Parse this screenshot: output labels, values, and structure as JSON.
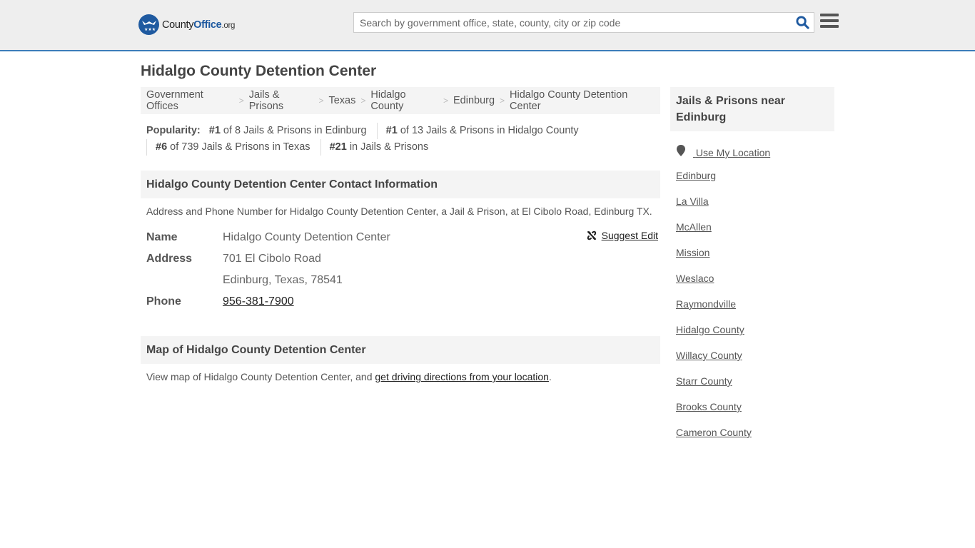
{
  "header": {
    "logo": {
      "text_main": "County",
      "text_bold": "Office",
      "text_suffix": ".org"
    },
    "search": {
      "placeholder": "Search by government office, state, county, city or zip code",
      "value": ""
    },
    "colors": {
      "brand": "#1f5aa0",
      "accent_border": "#3c7dba"
    }
  },
  "page": {
    "title": "Hidalgo County Detention Center"
  },
  "breadcrumb": [
    {
      "label": "Government Offices"
    },
    {
      "label": "Jails & Prisons"
    },
    {
      "label": "Texas"
    },
    {
      "label": "Hidalgo County"
    },
    {
      "label": "Edinburg"
    },
    {
      "label": "Hidalgo County Detention Center"
    }
  ],
  "popularity": {
    "label": "Popularity:",
    "items": [
      {
        "rank": "#1",
        "text": " of 8 Jails & Prisons in Edinburg"
      },
      {
        "rank": "#1",
        "text": " of 13 Jails & Prisons in Hidalgo County"
      },
      {
        "rank": "#6",
        "text": " of 739 Jails & Prisons in Texas"
      },
      {
        "rank": "#21",
        "text": " in Jails & Prisons"
      }
    ]
  },
  "contact": {
    "heading": "Hidalgo County Detention Center Contact Information",
    "description": "Address and Phone Number for Hidalgo County Detention Center, a Jail & Prison, at El Cibolo Road, Edinburg TX.",
    "suggest_edit": "Suggest Edit",
    "fields": {
      "name_label": "Name",
      "name_value": "Hidalgo County Detention Center",
      "address_label": "Address",
      "address_line1": "701 El Cibolo Road",
      "address_line2": "Edinburg, Texas, 78541",
      "phone_label": "Phone",
      "phone_value": "956-381-7900"
    }
  },
  "map": {
    "heading": "Map of Hidalgo County Detention Center",
    "text_before": "View map of Hidalgo County Detention Center, and ",
    "link": "get driving directions from your location",
    "text_after": "."
  },
  "sidebar": {
    "heading": "Jails & Prisons near Edinburg",
    "use_location": "Use My Location",
    "links": [
      "Edinburg",
      "La Villa",
      "McAllen",
      "Mission",
      "Weslaco",
      "Raymondville",
      "Hidalgo County",
      "Willacy County",
      "Starr County",
      "Brooks County",
      "Cameron County"
    ]
  }
}
